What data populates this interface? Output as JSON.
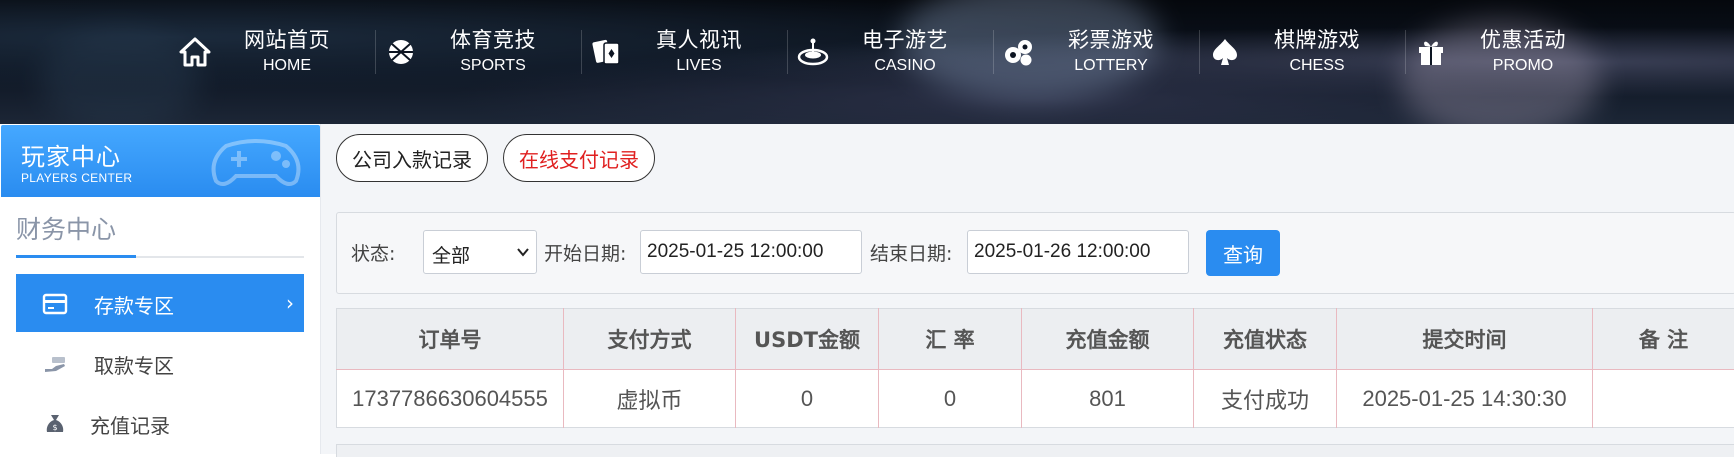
{
  "nav": {
    "items": [
      {
        "zh": "网站首页",
        "en": "HOME",
        "icon": "home-icon"
      },
      {
        "zh": "体育竞技",
        "en": "SPORTS",
        "icon": "basketball-icon"
      },
      {
        "zh": "真人视讯",
        "en": "LIVES",
        "icon": "cards-icon"
      },
      {
        "zh": "电子游艺",
        "en": "CASINO",
        "icon": "roulette-icon"
      },
      {
        "zh": "彩票游戏",
        "en": "LOTTERY",
        "icon": "lottery-balls-icon"
      },
      {
        "zh": "棋牌游戏",
        "en": "CHESS",
        "icon": "spade-icon"
      },
      {
        "zh": "优惠活动",
        "en": "PROMO",
        "icon": "gift-icon"
      }
    ]
  },
  "sidebar": {
    "banner_zh": "玩家中心",
    "banner_en": "PLAYERS CENTER",
    "section_title": "财务中心",
    "items": [
      {
        "label": "存款专区",
        "icon": "deposit-card-icon",
        "active": true
      },
      {
        "label": "取款专区",
        "icon": "withdraw-cash-icon",
        "active": false
      },
      {
        "label": "充值记录",
        "icon": "money-bag-icon",
        "active": false
      }
    ]
  },
  "tabs": {
    "company": "公司入款记录",
    "online": "在线支付记录"
  },
  "filter": {
    "status_label": "状态:",
    "status_value": "全部",
    "start_label": "开始日期:",
    "start_value": "2025-01-25 12:00:00",
    "end_label": "结束日期:",
    "end_value": "2025-01-26 12:00:00",
    "query_label": "查询"
  },
  "table": {
    "headers": [
      "订单号",
      "支付方式",
      "USDT金额",
      "汇 率",
      "充值金额",
      "充值状态",
      "提交时间",
      "备 注"
    ],
    "rows": [
      [
        "1737786630604555",
        "虚拟币",
        "0",
        "0",
        "801",
        "支付成功",
        "2025-01-25 14:30:30",
        ""
      ]
    ]
  },
  "colors": {
    "accent": "#2a8cf0",
    "selected_tab_text": "#e02020",
    "table_border": "#e9b9c0"
  }
}
